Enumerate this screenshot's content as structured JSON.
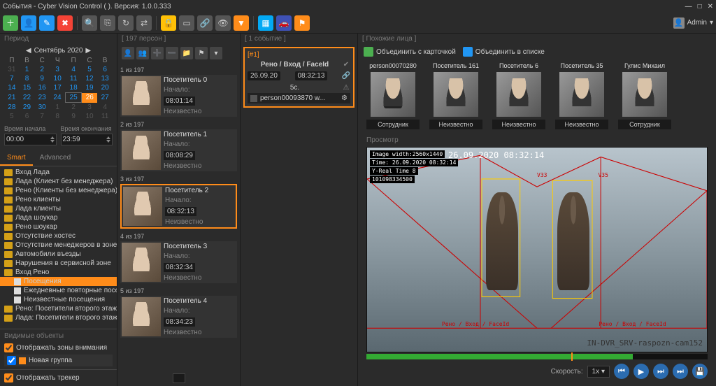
{
  "title": "События - Cyber Vision Control (                    ). Версия: 1.0.0.333",
  "user": {
    "name": "Admin",
    "menu_icon": "▾"
  },
  "toolbar_icons": [
    "add",
    "person",
    "edit",
    "delete",
    "binoculars",
    "copy",
    "refresh",
    "sync",
    "lock",
    "card",
    "link",
    "eye",
    "filter",
    "image",
    "car",
    "flag"
  ],
  "left": {
    "period_label": "Период",
    "month": "Сентябрь 2020",
    "dow": [
      "П",
      "В",
      "С",
      "Ч",
      "П",
      "С",
      "В"
    ],
    "weeks": [
      [
        {
          "d": "31",
          "dim": true
        },
        {
          "d": "1"
        },
        {
          "d": "2"
        },
        {
          "d": "3"
        },
        {
          "d": "4"
        },
        {
          "d": "5"
        },
        {
          "d": "6"
        }
      ],
      [
        {
          "d": "7"
        },
        {
          "d": "8"
        },
        {
          "d": "9"
        },
        {
          "d": "10"
        },
        {
          "d": "11"
        },
        {
          "d": "12"
        },
        {
          "d": "13"
        }
      ],
      [
        {
          "d": "14"
        },
        {
          "d": "15"
        },
        {
          "d": "16"
        },
        {
          "d": "17"
        },
        {
          "d": "18"
        },
        {
          "d": "19"
        },
        {
          "d": "20"
        }
      ],
      [
        {
          "d": "21"
        },
        {
          "d": "22"
        },
        {
          "d": "23"
        },
        {
          "d": "24"
        },
        {
          "d": "25",
          "today": true
        },
        {
          "d": "26",
          "sel": true
        },
        {
          "d": "27"
        }
      ],
      [
        {
          "d": "28"
        },
        {
          "d": "29"
        },
        {
          "d": "30"
        },
        {
          "d": "1",
          "dim": true
        },
        {
          "d": "2",
          "dim": true
        },
        {
          "d": "3",
          "dim": true
        },
        {
          "d": "4",
          "dim": true
        }
      ],
      [
        {
          "d": "5",
          "dim": true
        },
        {
          "d": "6",
          "dim": true
        },
        {
          "d": "7",
          "dim": true
        },
        {
          "d": "8",
          "dim": true
        },
        {
          "d": "9",
          "dim": true
        },
        {
          "d": "10",
          "dim": true
        },
        {
          "d": "11",
          "dim": true
        }
      ]
    ],
    "time_start_label": "Время начала",
    "time_start": "00:00",
    "time_end_label": "Время окончания",
    "time_end": "23:59",
    "tabs": {
      "smart": "Smart",
      "advanced": "Advanced"
    },
    "tree": [
      {
        "t": "Вход Лада"
      },
      {
        "t": "Лада (Клиент без менеджера)"
      },
      {
        "t": "Рено (Клиенты без менеджера)"
      },
      {
        "t": "Рено клиенты"
      },
      {
        "t": "Лада клиенты"
      },
      {
        "t": "Лада шоукар"
      },
      {
        "t": "Рено шоукар"
      },
      {
        "t": "Отсутствие хостес"
      },
      {
        "t": "Отсутствие менеджеров в зоне ..."
      },
      {
        "t": "Автомобили въезды"
      },
      {
        "t": "Нарушения в сервисной зоне"
      },
      {
        "t": "Вход Рено",
        "open": true
      },
      {
        "t": "Посещения",
        "ind": 1,
        "sel": true,
        "file": true
      },
      {
        "t": "Ежедневные повторные посе...",
        "ind": 1,
        "file": true
      },
      {
        "t": "Неизвестные посещения",
        "ind": 1,
        "file": true
      },
      {
        "t": "Рено: Посетители второго этажа"
      },
      {
        "t": "Лада: Посетители второго этажа"
      }
    ],
    "visible_label": "Видимые объекты",
    "show_zones": "Отображать зоны внимания",
    "group_name": "Новая группа",
    "show_tracker": "Отображать трекер"
  },
  "persons": {
    "header": "[ 197 персон ]",
    "start_label": "Начало:",
    "status_unknown": "Неизвестно",
    "list": [
      {
        "idx": "1 из 197",
        "name": "Посетитель 0",
        "time": "08:01:14"
      },
      {
        "idx": "2 из 197",
        "name": "Посетитель 1",
        "time": "08:08:29"
      },
      {
        "idx": "3 из 197",
        "name": "Посетитель 2",
        "time": "08:32:13",
        "sel": true
      },
      {
        "idx": "4 из 197",
        "name": "Посетитель 3",
        "time": "08:32:34"
      },
      {
        "idx": "5 из 197",
        "name": "Посетитель 4",
        "time": "08:34:23"
      }
    ]
  },
  "event": {
    "header": "[ 1 событие ]",
    "tag": "[#1]",
    "zone": "Рено / Вход / FaceId",
    "date": "26.09.20",
    "time": "08:32:13",
    "duration": "5с.",
    "person": "person00093870 w..."
  },
  "similar": {
    "header": "[ Похожие лица ]",
    "merge_card": "Объединить с карточкой",
    "merge_list": "Объединить в списке",
    "status_emp": "Сотрудник",
    "status_unk": "Неизвестно",
    "items": [
      {
        "name": "person00070280",
        "status": "emp",
        "mask": true
      },
      {
        "name": "Посетитель 161",
        "status": "unk"
      },
      {
        "name": "Посетитель 6",
        "status": "unk"
      },
      {
        "name": "Посетитель 35",
        "status": "unk"
      },
      {
        "name": "Гулис Михаил",
        "status": "emp"
      }
    ]
  },
  "view": {
    "header": "Просмотр",
    "overlays": [
      "Image width:2560x1440",
      "Time: 26.09.2020 08:32:14",
      "Y-Real Time 8",
      "101098334500"
    ],
    "timestamp": "26.09.2020 08:32:14",
    "cam": "IN-DVR_SRV-raspozn-cam152",
    "zone_labels": [
      "Рено / Вход / FaceId",
      "Рено / Вход / FaceId"
    ],
    "vertex": [
      "V33",
      "V35"
    ],
    "speed_label": "Скорость:",
    "speed": "1x"
  }
}
